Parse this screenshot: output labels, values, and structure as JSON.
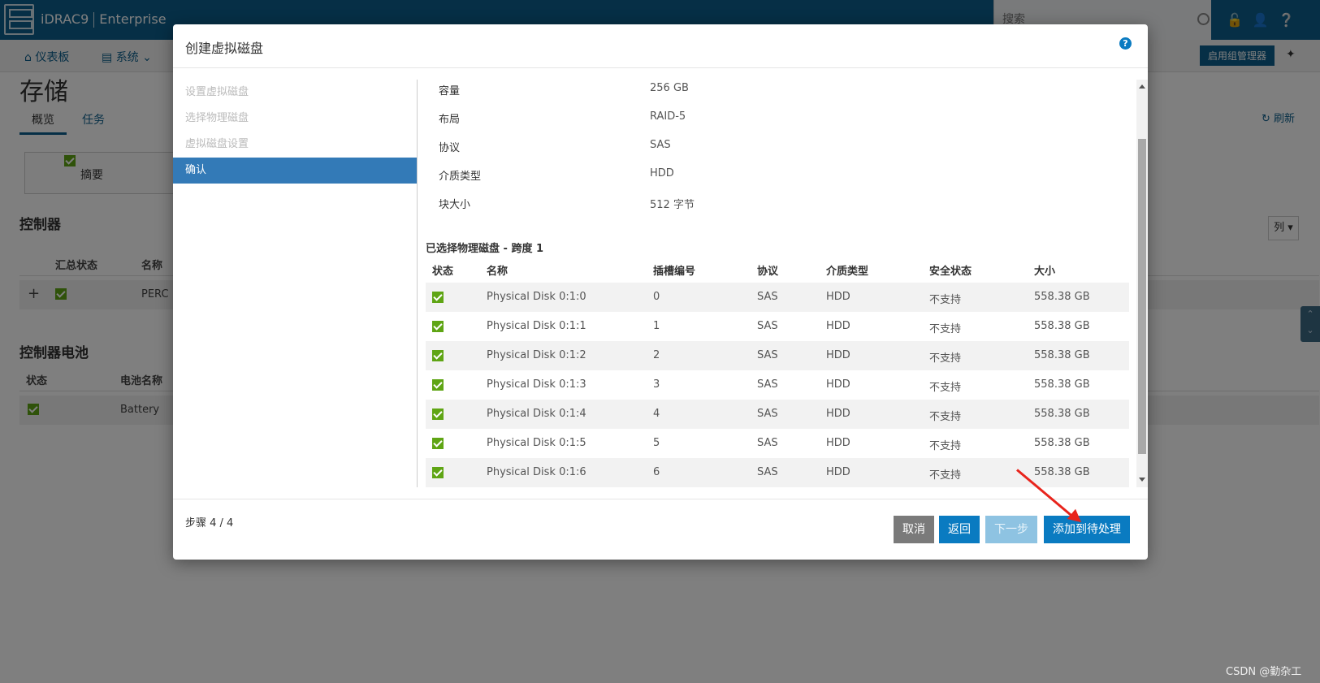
{
  "header": {
    "brand": "iDRAC9",
    "edition": "Enterprise",
    "search_placeholder": "搜索"
  },
  "nav": {
    "dashboard": "仪表板",
    "system": "系统",
    "group_manager": "启用组管理器"
  },
  "page": {
    "title": "存储",
    "tabs": [
      "概览",
      "任务"
    ],
    "refresh": "刷新",
    "summary": "摘要",
    "controllers_title": "控制器",
    "controllers_headers": [
      "汇总状态",
      "名称"
    ],
    "controller_row_name": "PERC",
    "battery_title": "控制器电池",
    "battery_headers": [
      "状态",
      "电池名称"
    ],
    "battery_row_name": "Battery",
    "columns_btn": "列"
  },
  "modal": {
    "title": "创建虚拟磁盘",
    "steps": [
      "设置虚拟磁盘",
      "选择物理磁盘",
      "虚拟磁盘设置",
      "确认"
    ],
    "active_step": 3,
    "summary": [
      {
        "label": "容量",
        "value": "256 GB"
      },
      {
        "label": "布局",
        "value": "RAID-5"
      },
      {
        "label": "协议",
        "value": "SAS"
      },
      {
        "label": "介质类型",
        "value": "HDD"
      },
      {
        "label": "块大小",
        "value": "512 字节"
      }
    ],
    "selected_title": "已选择物理磁盘 - 跨度 1",
    "table_headers": [
      "状态",
      "名称",
      "插槽编号",
      "协议",
      "介质类型",
      "安全状态",
      "大小"
    ],
    "disks": [
      {
        "name": "Physical Disk 0:1:0",
        "slot": "0",
        "protocol": "SAS",
        "media": "HDD",
        "security": "不支持",
        "size": "558.38 GB"
      },
      {
        "name": "Physical Disk 0:1:1",
        "slot": "1",
        "protocol": "SAS",
        "media": "HDD",
        "security": "不支持",
        "size": "558.38 GB"
      },
      {
        "name": "Physical Disk 0:1:2",
        "slot": "2",
        "protocol": "SAS",
        "media": "HDD",
        "security": "不支持",
        "size": "558.38 GB"
      },
      {
        "name": "Physical Disk 0:1:3",
        "slot": "3",
        "protocol": "SAS",
        "media": "HDD",
        "security": "不支持",
        "size": "558.38 GB"
      },
      {
        "name": "Physical Disk 0:1:4",
        "slot": "4",
        "protocol": "SAS",
        "media": "HDD",
        "security": "不支持",
        "size": "558.38 GB"
      },
      {
        "name": "Physical Disk 0:1:5",
        "slot": "5",
        "protocol": "SAS",
        "media": "HDD",
        "security": "不支持",
        "size": "558.38 GB"
      },
      {
        "name": "Physical Disk 0:1:6",
        "slot": "6",
        "protocol": "SAS",
        "media": "HDD",
        "security": "不支持",
        "size": "558.38 GB"
      }
    ],
    "step_count": "步骤 4 / 4",
    "buttons": {
      "cancel": "取消",
      "back": "返回",
      "next": "下一步",
      "add": "添加到待处理"
    }
  },
  "watermark": "CSDN @勤杂工",
  "colors": {
    "brand_blue": "#0c5f8c",
    "button_blue": "#0a7bc1",
    "status_green": "#5fa514",
    "annotation_red": "#e8241c"
  }
}
